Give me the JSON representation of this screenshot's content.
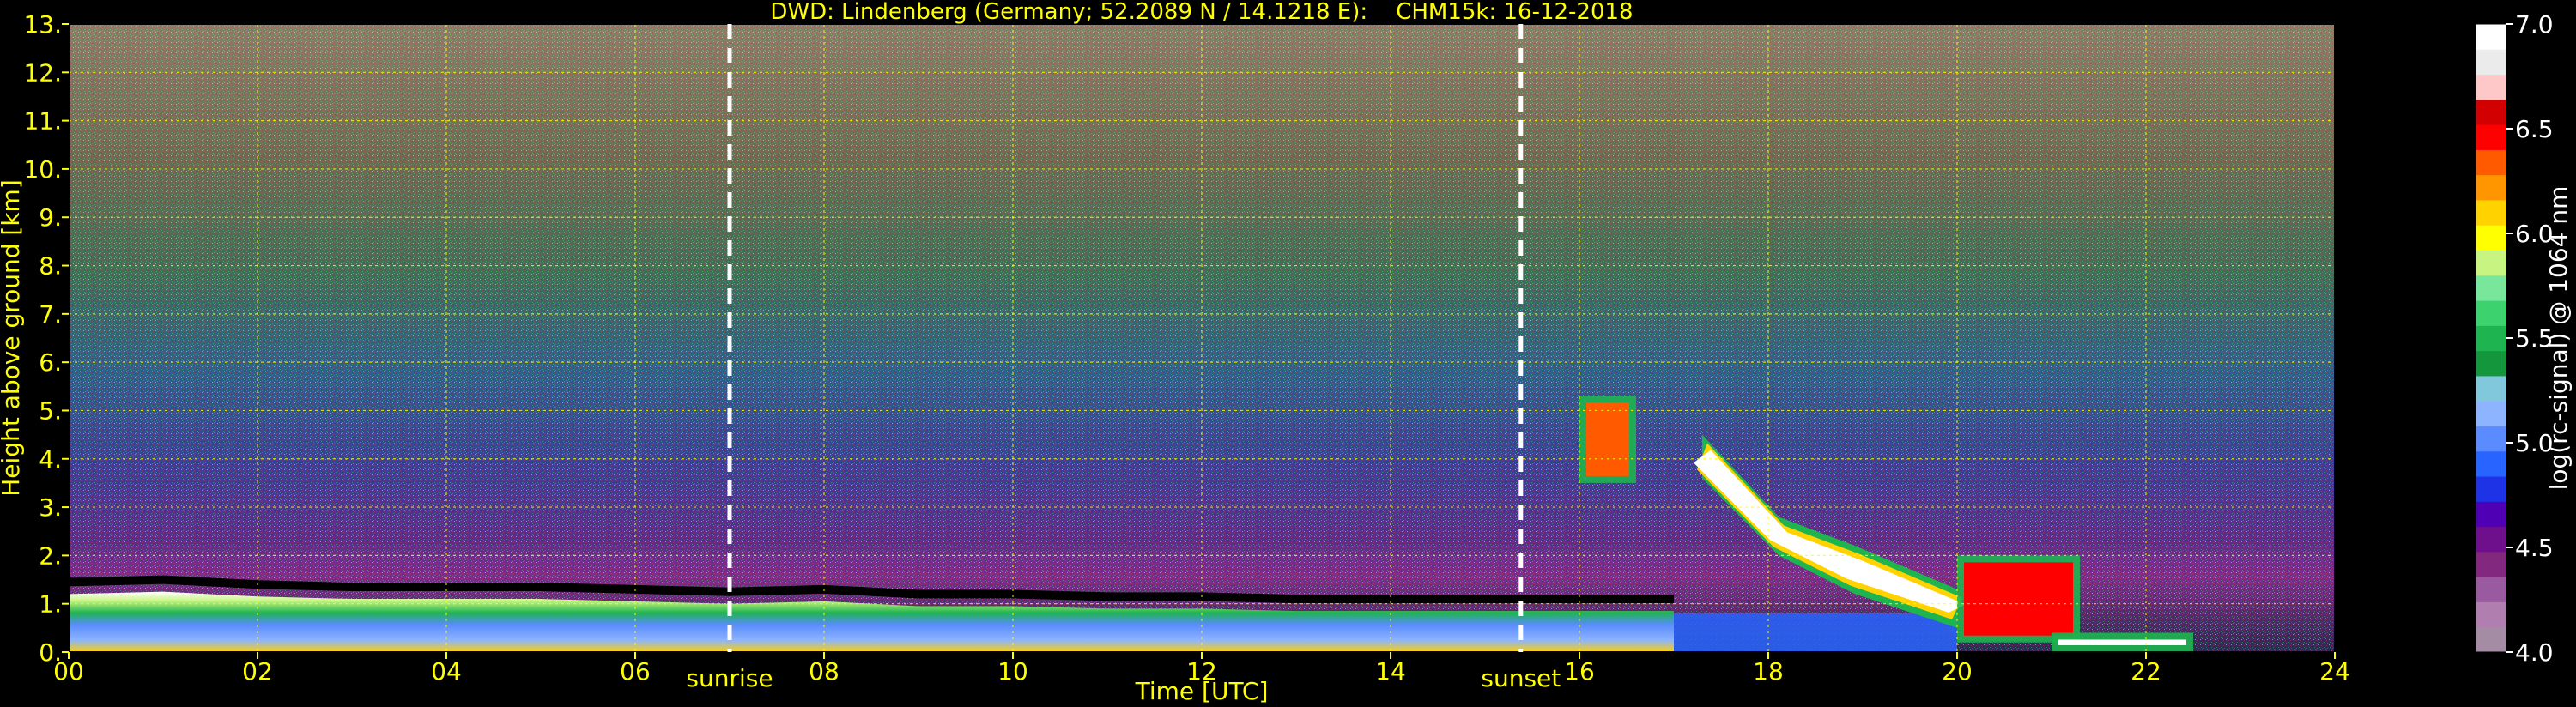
{
  "chart_data": {
    "type": "heatmap",
    "title": "DWD: Lindenberg (Germany; 52.2089 N / 14.1218 E):    CHM15k: 16-12-2018",
    "xlabel": "Time [UTC]",
    "ylabel": "Height above ground [km]",
    "xlim": [
      0,
      24
    ],
    "ylim": [
      0,
      13
    ],
    "x_ticks": [
      0,
      2,
      4,
      6,
      8,
      10,
      12,
      14,
      16,
      18,
      20,
      22,
      24
    ],
    "x_tick_labels": [
      "00",
      "02",
      "04",
      "06",
      "08",
      "10",
      "12",
      "14",
      "16",
      "18",
      "20",
      "22",
      "24"
    ],
    "y_ticks": [
      0,
      1,
      2,
      3,
      4,
      5,
      6,
      7,
      8,
      9,
      10,
      11,
      12,
      13
    ],
    "y_tick_labels": [
      "0.",
      "1.",
      "2.",
      "3.",
      "4.",
      "5.",
      "6.",
      "7.",
      "8.",
      "9.",
      "10.",
      "11.",
      "12.",
      "13."
    ],
    "grid": true,
    "colorbar": {
      "label": "log(rc-signal) @ 1064 nm",
      "range": [
        4.0,
        7.0
      ],
      "ticks": [
        4.0,
        4.5,
        5.0,
        5.5,
        6.0,
        6.5,
        7.0
      ],
      "tick_labels": [
        "4.0",
        "4.5",
        "5.0",
        "5.5",
        "6.0",
        "6.5",
        "7.0"
      ],
      "colors": [
        "#a58ca5",
        "#b07fb0",
        "#9a5aa0",
        "#82287f",
        "#6e0f8c",
        "#5000b4",
        "#1e32e6",
        "#2864ff",
        "#5a8cff",
        "#8cb4ff",
        "#82c8dc",
        "#14963c",
        "#1eb450",
        "#3cd26e",
        "#78e69b",
        "#c8f582",
        "#ffff00",
        "#ffd200",
        "#ff9600",
        "#ff5a00",
        "#ff0000",
        "#d20000",
        "#ffc8c8",
        "#ebebeb",
        "#ffffff"
      ]
    },
    "markers": [
      {
        "label": "sunrise",
        "x": 7.0
      },
      {
        "label": "sunset",
        "x": 15.38
      }
    ],
    "features": {
      "boundary_layer_top_km": [
        [
          0,
          1.2
        ],
        [
          1,
          1.25
        ],
        [
          2,
          1.15
        ],
        [
          3,
          1.1
        ],
        [
          4,
          1.1
        ],
        [
          5,
          1.1
        ],
        [
          6,
          1.05
        ],
        [
          7,
          1.0
        ],
        [
          8,
          1.05
        ],
        [
          9,
          0.95
        ],
        [
          10,
          0.95
        ],
        [
          11,
          0.9
        ],
        [
          12,
          0.9
        ],
        [
          13,
          0.85
        ],
        [
          14,
          0.85
        ],
        [
          15,
          0.85
        ],
        [
          15.38,
          0.85
        ],
        [
          16,
          0.85
        ],
        [
          17,
          0.85
        ]
      ],
      "cloud_layers": [
        {
          "start_hour": 16.0,
          "end_hour": 16.6,
          "base_km": 3.5,
          "top_km": 5.3
        },
        {
          "start_hour": 17.3,
          "end_hour": 20.0,
          "base_km": 0.5,
          "top_km": 4.5
        },
        {
          "start_hour": 20.0,
          "end_hour": 21.3,
          "base_km": 0.2,
          "top_km": 2.0
        },
        {
          "start_hour": 21.0,
          "end_hour": 22.5,
          "base_km": 0.0,
          "top_km": 0.4
        }
      ]
    }
  }
}
